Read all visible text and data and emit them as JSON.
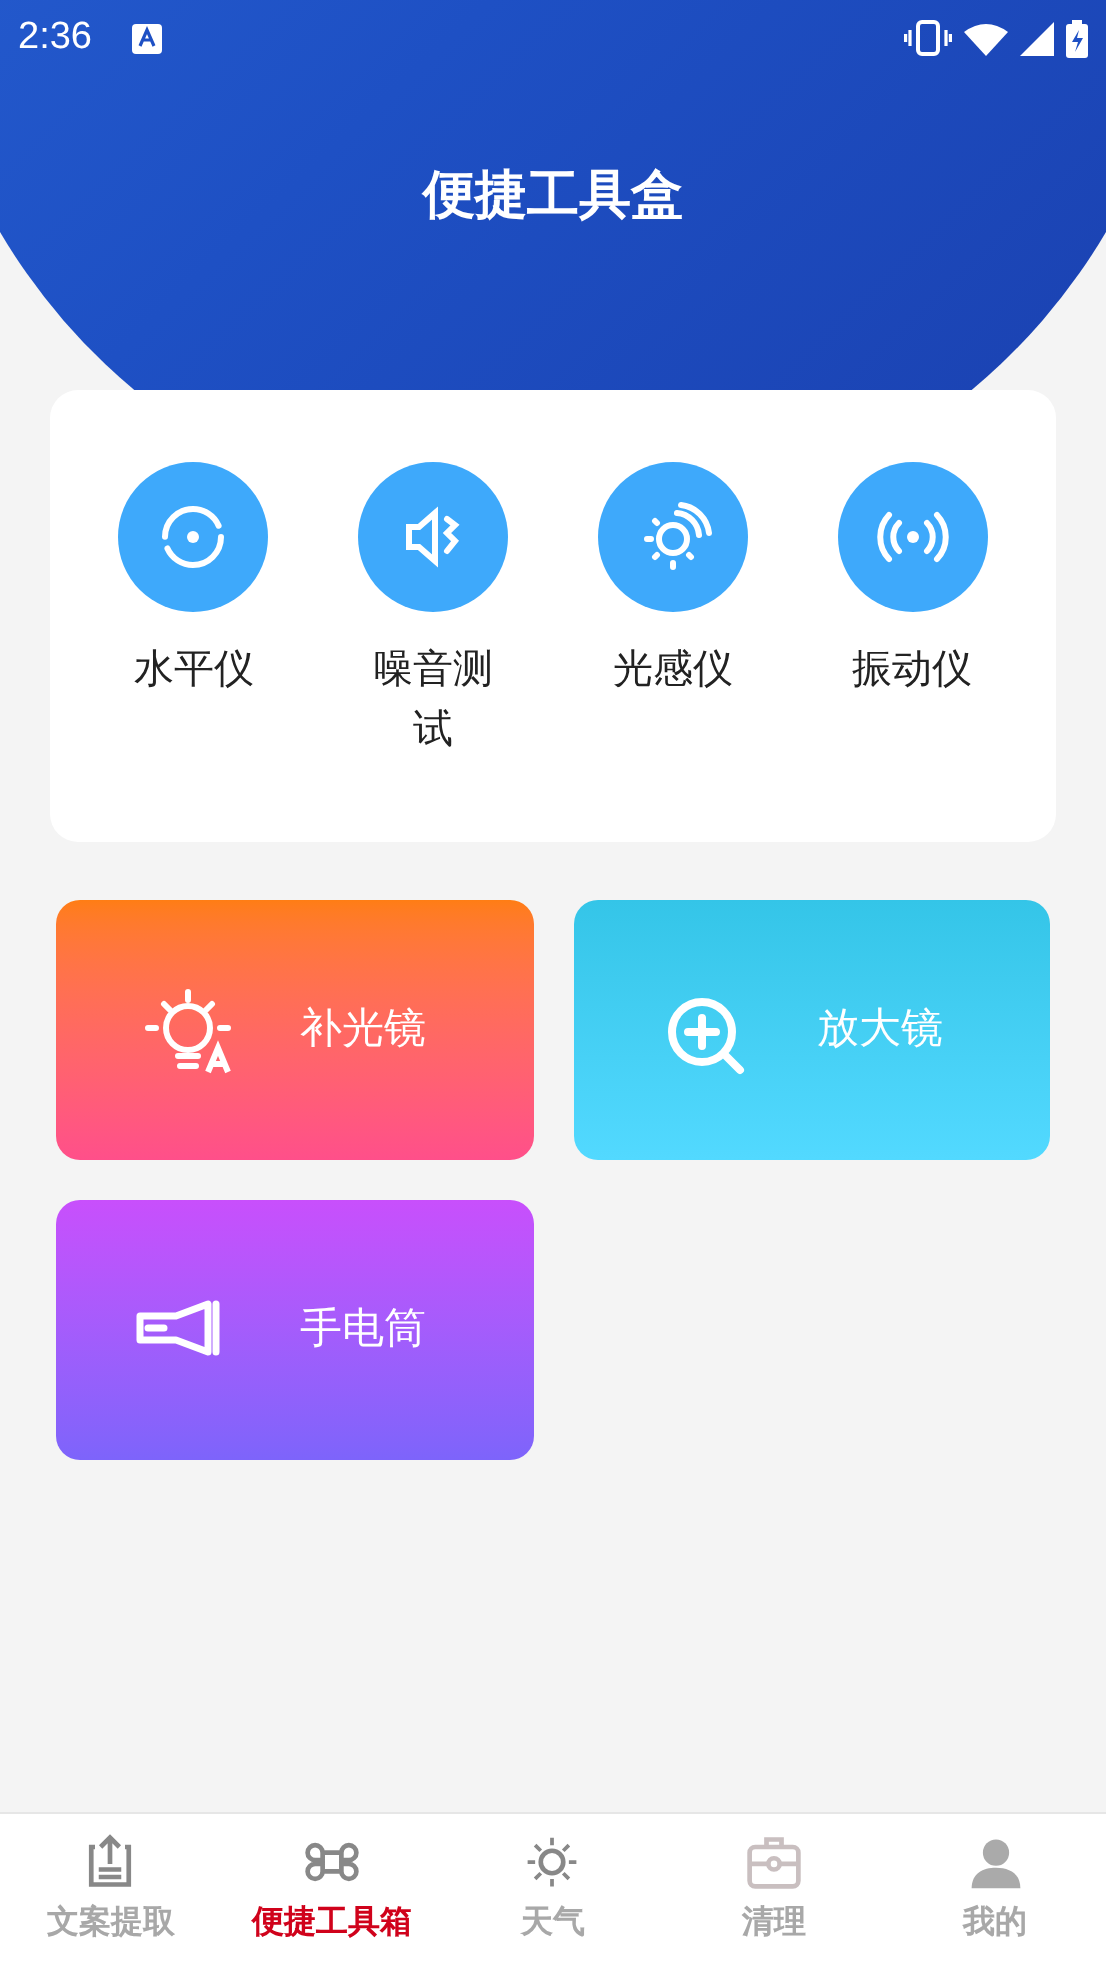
{
  "status_bar": {
    "time": "2:36"
  },
  "header": {
    "title": "便捷工具盒"
  },
  "tools": [
    {
      "kind": "level",
      "label": "水平仪"
    },
    {
      "kind": "noise",
      "label": "噪音测试"
    },
    {
      "kind": "light",
      "label": "光感仪"
    },
    {
      "kind": "vibration",
      "label": "振动仪"
    }
  ],
  "tiles": [
    {
      "kind": "fill-light",
      "label": "补光镜"
    },
    {
      "kind": "magnifier",
      "label": "放大镜"
    },
    {
      "kind": "flashlight",
      "label": "手电筒"
    }
  ],
  "nav": [
    {
      "kind": "extract",
      "label": "文案提取",
      "selected": false
    },
    {
      "kind": "toolbox",
      "label": "便捷工具箱",
      "selected": true
    },
    {
      "kind": "weather",
      "label": "天气",
      "selected": false
    },
    {
      "kind": "clean",
      "label": "清理",
      "selected": false
    },
    {
      "kind": "me",
      "label": "我的",
      "selected": false
    }
  ]
}
